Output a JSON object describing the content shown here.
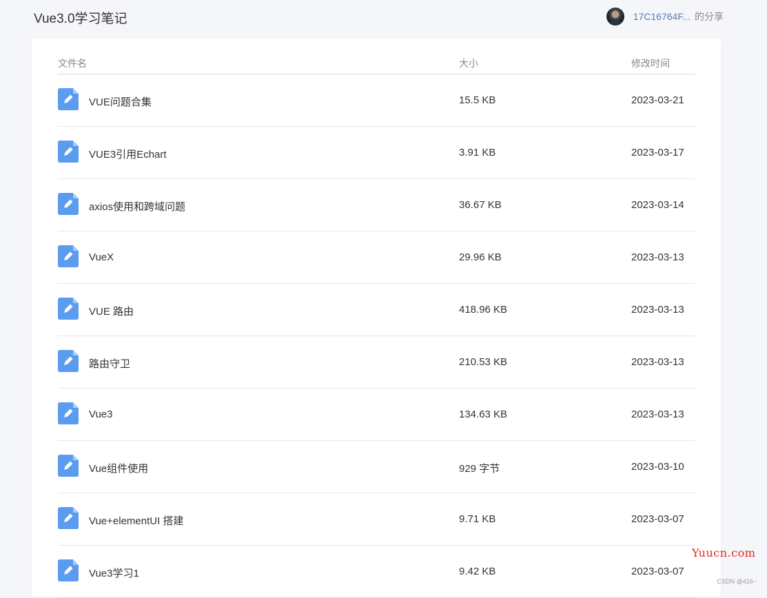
{
  "header": {
    "title": "Vue3.0学习笔记",
    "owner": "17C16764F...",
    "share_suffix": "的分享"
  },
  "table": {
    "columns": [
      "文件名",
      "大小",
      "修改时间"
    ],
    "rows": [
      {
        "icon": "document-edit-icon",
        "name": "VUE问题合集",
        "size": "15.5 KB",
        "date": "2023-03-21"
      },
      {
        "icon": "document-edit-icon",
        "name": "VUE3引用Echart",
        "size": "3.91 KB",
        "date": "2023-03-17"
      },
      {
        "icon": "document-edit-icon",
        "name": "axios使用和跨域问题",
        "size": "36.67 KB",
        "date": "2023-03-14"
      },
      {
        "icon": "document-edit-icon",
        "name": "VueX",
        "size": "29.96 KB",
        "date": "2023-03-13"
      },
      {
        "icon": "document-edit-icon",
        "name": "VUE 路由",
        "size": "418.96 KB",
        "date": "2023-03-13"
      },
      {
        "icon": "document-edit-icon",
        "name": "路由守卫",
        "size": "210.53 KB",
        "date": "2023-03-13"
      },
      {
        "icon": "document-edit-icon",
        "name": "Vue3",
        "size": "134.63 KB",
        "date": "2023-03-13"
      },
      {
        "icon": "document-edit-icon",
        "name": "Vue组件使用",
        "size": "929 字节",
        "date": "2023-03-10"
      },
      {
        "icon": "document-edit-icon",
        "name": "Vue+elementUI 搭建",
        "size": "9.71 KB",
        "date": "2023-03-07"
      },
      {
        "icon": "document-edit-icon",
        "name": "Vue3学习1",
        "size": "9.42 KB",
        "date": "2023-03-07"
      }
    ]
  },
  "watermarks": {
    "site": "Yuucn.com",
    "credit": "CSDN @416~"
  },
  "colors": {
    "icon_blue": "#5b9bf0",
    "owner_link": "#5b7bb2",
    "watermark_red": "#e0281f"
  }
}
